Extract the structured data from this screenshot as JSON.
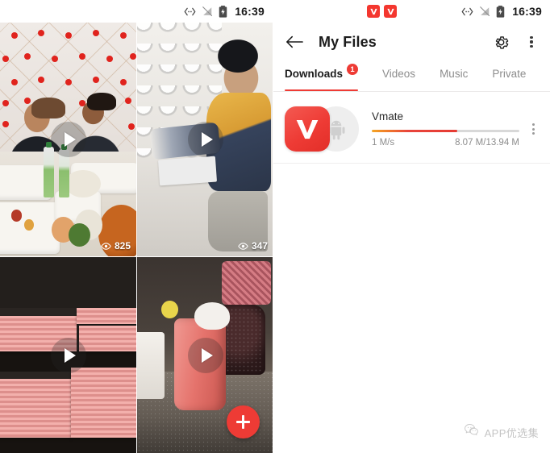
{
  "left_phone": {
    "status_bar": {
      "time": "16:39",
      "icons": [
        "usb-debugging-icon",
        "signal-off-icon",
        "battery-charging-icon"
      ]
    },
    "video_grid": {
      "items": [
        {
          "id": "video-1",
          "description": "Two men eating a meal at a table with white tent backdrop and red dots",
          "views": "825",
          "has_play_button": true,
          "view_icon": "eye-icon"
        },
        {
          "id": "video-2",
          "description": "Man applying decorative scalloped plaster texture to a wall",
          "views": "347",
          "has_play_button": true,
          "view_icon": "eye-icon"
        },
        {
          "id": "video-3",
          "description": "Stacks of pink copper sheets on dark shelves",
          "views": "",
          "has_play_button": true,
          "view_icon": "eye-icon"
        },
        {
          "id": "video-4",
          "description": "Pink jar with foam on a kitchen counter next to a scrub sponge",
          "views": "",
          "has_play_button": true,
          "view_icon": "eye-icon"
        }
      ]
    },
    "fab": {
      "label": "+",
      "name": "add-button",
      "color": "#ee3b35"
    }
  },
  "right_phone": {
    "status_bar": {
      "time": "16:39",
      "notification_icons": [
        "vmate-notification-icon",
        "vmate-notification-icon"
      ],
      "icons": [
        "usb-debugging-icon",
        "signal-off-icon",
        "battery-charging-icon"
      ]
    },
    "appbar": {
      "back_icon": "back-arrow-icon",
      "title": "My Files",
      "settings_icon": "gear-icon",
      "overflow_icon": "more-vertical-icon"
    },
    "tabs": [
      {
        "label": "Downloads",
        "badge": "1",
        "active": true
      },
      {
        "label": "Videos",
        "badge": "",
        "active": false
      },
      {
        "label": "Music",
        "badge": "",
        "active": false
      },
      {
        "label": "Private",
        "badge": "",
        "active": false
      }
    ],
    "downloads": [
      {
        "name": "Vmate",
        "icon": "vmate-app-icon",
        "file_type_icon": "android-apk-icon",
        "speed": "1 M/s",
        "size": "8.07 M/13.94 M",
        "progress_percent": 58,
        "overflow_icon": "more-vertical-icon"
      }
    ],
    "watermark": {
      "text": "APP优选集",
      "logo": "wechat-logo-icon"
    }
  },
  "colors": {
    "accent_red": "#ee3b35",
    "progress_start": "#f5a623",
    "text_primary": "#1c1c1c",
    "text_secondary": "#8d8d8d",
    "track_gray": "#d8d8d8"
  }
}
